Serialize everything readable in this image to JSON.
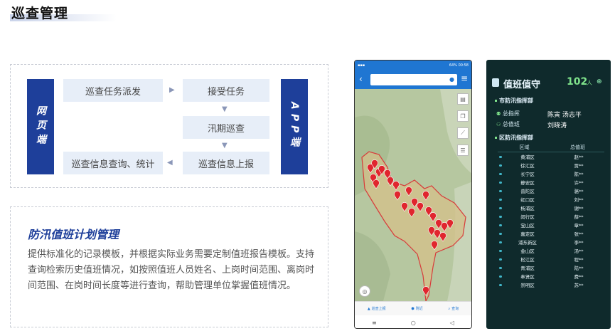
{
  "page_title": "巡查管理",
  "flow": {
    "left_tag": "网页端",
    "right_tag": "APP端",
    "steps": {
      "dispatch": "巡查任务派发",
      "accept": "接受任务",
      "flood_patrol": "汛期巡查",
      "report": "巡查信息上报",
      "query": "巡查信息查询、统计"
    }
  },
  "description": {
    "title": "防汛值班计划管理",
    "text": "提供标准化的记录模板，并根据实际业务需要定制值班报告模板。支持查询检索历史值班情况，如按照值班人员姓名、上岗时间范围、离岗时间范围、在岗时间长度等进行查询，帮助管理单位掌握值班情况。"
  },
  "phone": {
    "status_time": "00:58",
    "status_battery": "64%",
    "tabs": [
      "巡查上报",
      "附近",
      "查询"
    ]
  },
  "duty": {
    "title": "值班值守",
    "count": "102",
    "unit": "人",
    "city_section": "市防汛指挥部",
    "leaders": [
      {
        "role": "总指挥",
        "name": "陈寅  汤志平"
      },
      {
        "role": "总值班",
        "name": "刘晓涛"
      }
    ],
    "district_section": "区防汛指挥部",
    "table_headers": [
      "区域",
      "总值班"
    ],
    "rows": [
      [
        "黄浦区",
        "赵**"
      ],
      [
        "徐汇区",
        "贾**"
      ],
      [
        "长宁区",
        "陈**"
      ],
      [
        "静安区",
        "许**"
      ],
      [
        "普陀区",
        "骆**"
      ],
      [
        "虹口区",
        "刘**"
      ],
      [
        "杨浦区",
        "谢**"
      ],
      [
        "闵行区",
        "薛**"
      ],
      [
        "宝山区",
        "章**"
      ],
      [
        "嘉定区",
        "张**"
      ],
      [
        "浦东新区",
        "李**"
      ],
      [
        "金山区",
        "汤**"
      ],
      [
        "松江区",
        "程**"
      ],
      [
        "青浦区",
        "陆**"
      ],
      [
        "奉贤区",
        "费**"
      ],
      [
        "崇明区",
        "苏**"
      ]
    ]
  }
}
